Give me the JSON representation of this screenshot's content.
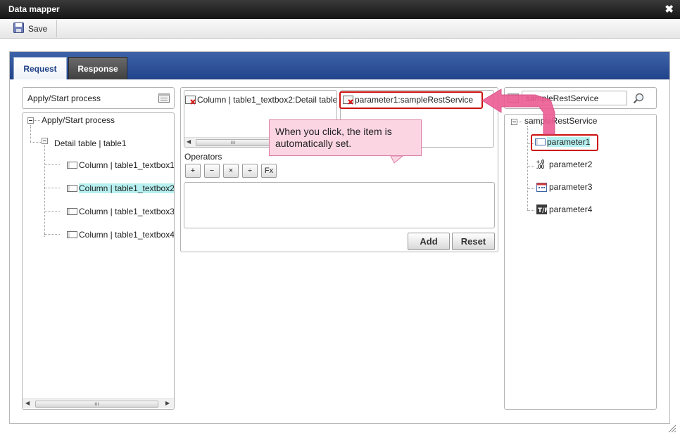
{
  "window": {
    "title": "Data mapper"
  },
  "toolbar": {
    "save_label": "Save"
  },
  "tabs": [
    {
      "label": "Request",
      "active": true
    },
    {
      "label": "Response",
      "active": false
    }
  ],
  "left": {
    "header": "Apply/Start process",
    "tree": {
      "root": "Apply/Start process",
      "table": "Detail table | table1",
      "columns": [
        "Column | table1_textbox1",
        "Column | table1_textbox2",
        "Column | table1_textbox3",
        "Column | table1_textbox4"
      ],
      "selected_index": 1
    }
  },
  "middle": {
    "source_field": "Column | table1_textbox2:Detail table",
    "target_field": "parameter1:sampleRestService",
    "operators_label": "Operators",
    "operators": [
      "+",
      "−",
      "×",
      "÷",
      "Fx"
    ],
    "add_label": "Add",
    "reset_label": "Reset"
  },
  "right": {
    "search_value": "sampleRestService",
    "tree": {
      "root": "sampleRestService",
      "params": [
        "parameter1",
        "parameter2",
        "parameter3",
        "parameter4"
      ],
      "selected_index": 0
    }
  },
  "annotation": {
    "callout": "When you click, the item is automatically set."
  },
  "colors": {
    "titlebar": "#1f1f1f",
    "tabbar": "#2b4f98",
    "selection": "#b7f0f0",
    "annotation": "#e64d86"
  }
}
